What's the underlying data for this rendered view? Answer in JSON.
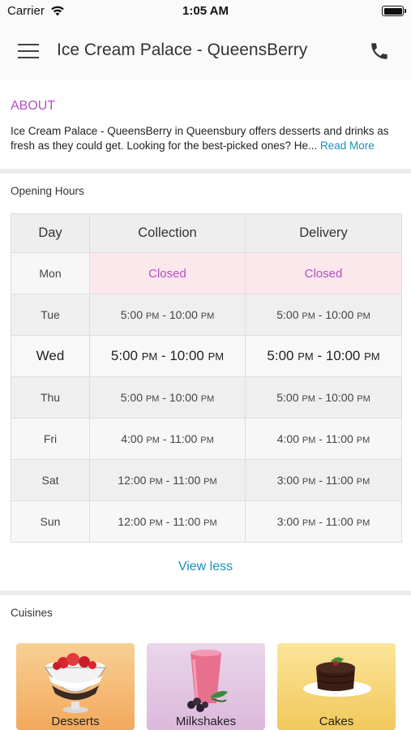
{
  "status_bar": {
    "carrier": "Carrier",
    "time": "1:05 AM"
  },
  "header": {
    "title": "Ice Cream Palace - QueensBerry",
    "menu_icon": "menu-icon",
    "phone_icon": "phone-icon"
  },
  "about": {
    "title": "ABOUT",
    "text": "Ice Cream Palace - QueensBerry in Queensbury offers desserts and drinks as fresh as they could get. Looking for the best-picked ones? He...",
    "read_more": "Read More"
  },
  "opening_hours": {
    "label": "Opening Hours",
    "columns": [
      "Day",
      "Collection",
      "Delivery"
    ],
    "rows": [
      {
        "day": "Mon",
        "collection": "Closed",
        "delivery": "Closed"
      },
      {
        "day": "Tue",
        "collection": {
          "from": "5:00",
          "from_ampm": "PM",
          "to": "10:00",
          "to_ampm": "PM"
        },
        "delivery": {
          "from": "5:00",
          "from_ampm": "PM",
          "to": "10:00",
          "to_ampm": "PM"
        }
      },
      {
        "day": "Wed",
        "collection": {
          "from": "5:00",
          "from_ampm": "PM",
          "to": "10:00",
          "to_ampm": "PM"
        },
        "delivery": {
          "from": "5:00",
          "from_ampm": "PM",
          "to": "10:00",
          "to_ampm": "PM"
        }
      },
      {
        "day": "Thu",
        "collection": {
          "from": "5:00",
          "from_ampm": "PM",
          "to": "10:00",
          "to_ampm": "PM"
        },
        "delivery": {
          "from": "5:00",
          "from_ampm": "PM",
          "to": "10:00",
          "to_ampm": "PM"
        }
      },
      {
        "day": "Fri",
        "collection": {
          "from": "4:00",
          "from_ampm": "PM",
          "to": "11:00",
          "to_ampm": "PM"
        },
        "delivery": {
          "from": "4:00",
          "from_ampm": "PM",
          "to": "11:00",
          "to_ampm": "PM"
        }
      },
      {
        "day": "Sat",
        "collection": {
          "from": "12:00",
          "from_ampm": "PM",
          "to": "11:00",
          "to_ampm": "PM"
        },
        "delivery": {
          "from": "3:00",
          "from_ampm": "PM",
          "to": "11:00",
          "to_ampm": "PM"
        }
      },
      {
        "day": "Sun",
        "collection": {
          "from": "12:00",
          "from_ampm": "PM",
          "to": "11:00",
          "to_ampm": "PM"
        },
        "delivery": {
          "from": "3:00",
          "from_ampm": "PM",
          "to": "11:00",
          "to_ampm": "PM"
        }
      }
    ],
    "view_less": "View less"
  },
  "cuisines": {
    "label": "Cuisines",
    "items": [
      {
        "label": "Desserts",
        "image": "dessert-bowl-image"
      },
      {
        "label": "Milkshakes",
        "image": "milkshake-glass-image"
      },
      {
        "label": "Cakes",
        "image": "chocolate-cake-image"
      }
    ]
  },
  "colors": {
    "accent_purple": "#b14fc5",
    "link_blue": "#1a8fb9",
    "closed_bg": "#fce7ec",
    "desserts_card": "#f4b97a",
    "milkshakes_card": "#e6c8e6",
    "cakes_card": "#f6d97a"
  }
}
